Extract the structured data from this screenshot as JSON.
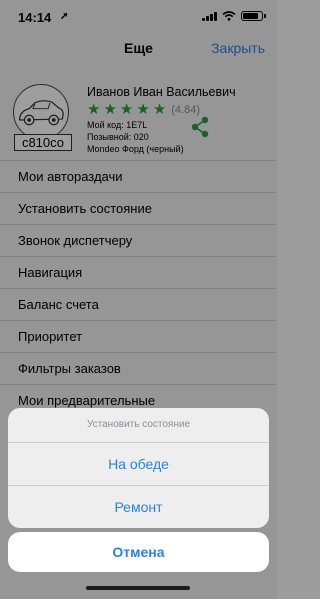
{
  "status_bar": {
    "time": "14:14",
    "location_glyph": "➚"
  },
  "header": {
    "title": "Еще",
    "close_label": "Закрыть"
  },
  "profile": {
    "plate": "с810со",
    "name": "Иванов Иван Васильевич",
    "stars": 5,
    "rating_text": "(4.84)",
    "code": "Мой код: 1E7L",
    "callsign": "Позывной: 020",
    "car": "Mondeo Форд (черный)"
  },
  "menu": {
    "items": [
      "Мои автораздачи",
      "Установить состояние",
      "Звонок диспетчеру",
      "Навигация",
      "Баланс счета",
      "Приоритет",
      "Фильтры заказов",
      "Мои предварительные"
    ]
  },
  "action_sheet": {
    "title": "Установить состояние",
    "option1": "На обеде",
    "option2": "Ремонт",
    "cancel": "Отмена"
  },
  "colors": {
    "accent": "#2f7fe0",
    "stars": "#2f9a46"
  },
  "icons": {
    "share": "share-icon",
    "location": "location-arrow-icon",
    "signal": "cellular-signal-icon",
    "wifi": "wifi-icon",
    "battery": "battery-icon",
    "avatar": "car-avatar-icon"
  }
}
